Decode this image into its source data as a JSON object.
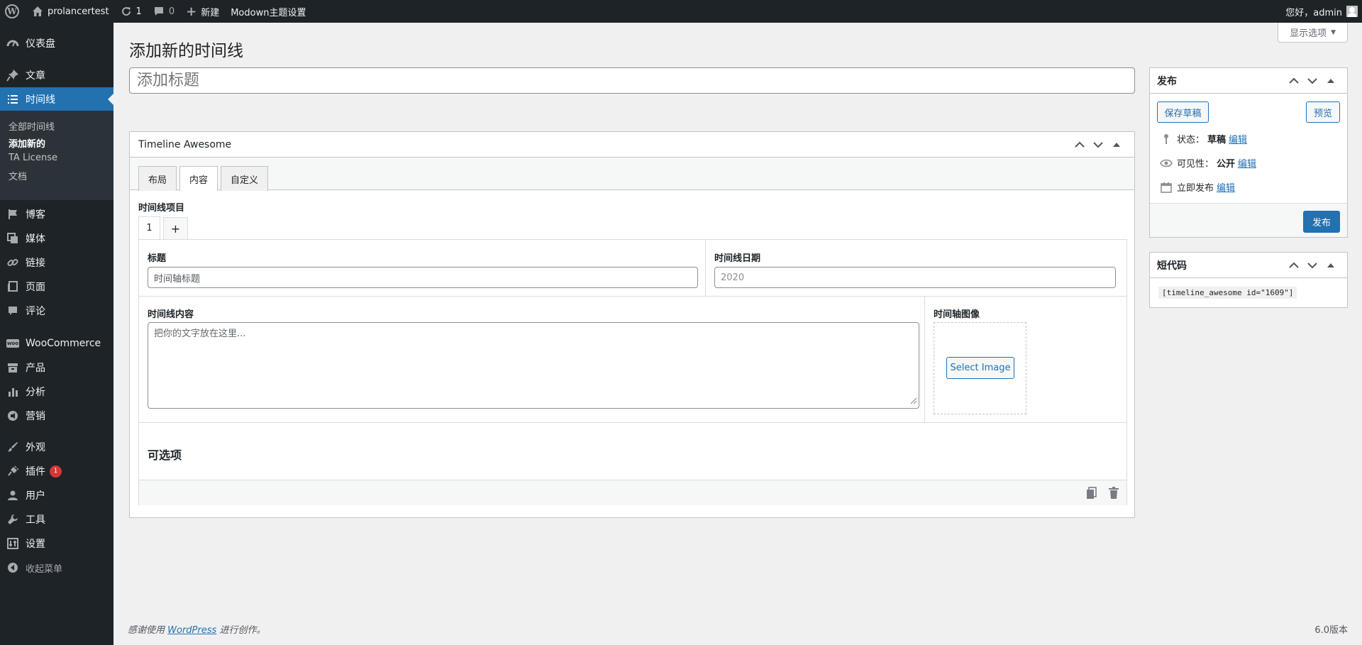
{
  "adminbar": {
    "site_name": "prolancertest",
    "updates_count": "1",
    "comments_count": "0",
    "new_label": "新建",
    "theme_settings": "Modown主题设置",
    "greeting": "您好，admin"
  },
  "sidebar": {
    "items": [
      {
        "label": "仪表盘",
        "icon": "dashboard-icon"
      },
      {
        "label": "文章",
        "icon": "pin-icon"
      },
      {
        "label": "时间线",
        "icon": "list-icon"
      },
      {
        "label": "博客",
        "icon": "flag-icon"
      },
      {
        "label": "媒体",
        "icon": "media-icon"
      },
      {
        "label": "链接",
        "icon": "link-icon"
      },
      {
        "label": "页面",
        "icon": "page-icon"
      },
      {
        "label": "评论",
        "icon": "comment-icon"
      },
      {
        "label": "WooCommerce",
        "icon": "woo-icon"
      },
      {
        "label": "产品",
        "icon": "archive-icon"
      },
      {
        "label": "分析",
        "icon": "chart-icon"
      },
      {
        "label": "营销",
        "icon": "megaphone-icon"
      },
      {
        "label": "外观",
        "icon": "brush-icon"
      },
      {
        "label": "插件",
        "icon": "plugin-icon"
      },
      {
        "label": "用户",
        "icon": "user-icon"
      },
      {
        "label": "工具",
        "icon": "wrench-icon"
      },
      {
        "label": "设置",
        "icon": "settings-icon"
      }
    ],
    "plugins_badge": "1",
    "submenu": [
      "全部时间线",
      "添加新的",
      "TA License",
      "文档"
    ],
    "collapse_label": "收起菜单"
  },
  "screen_options": "显示选项",
  "page_title": "添加新的时间线",
  "title_placeholder": "添加标题",
  "timeline_box": {
    "title": "Timeline Awesome",
    "tabs": [
      "布局",
      "内容",
      "自定义"
    ],
    "items_label": "时间线项目",
    "item_tabs": [
      "1",
      "+"
    ],
    "title_label": "标题",
    "title_value": "时间轴标题",
    "date_label": "时间线日期",
    "date_placeholder": "2020",
    "content_label": "时间线内容",
    "content_placeholder": "把你的文字放在这里...",
    "image_label": "时间轴图像",
    "select_image": "Select Image",
    "optional_label": "可选项"
  },
  "publish_box": {
    "title": "发布",
    "save_draft": "保存草稿",
    "preview": "预览",
    "status_label": "状态：",
    "status_value": "草稿",
    "visibility_label": "可见性：",
    "visibility_value": "公开",
    "publish_time": "立即发布",
    "edit_link": "编辑",
    "publish_button": "发布"
  },
  "shortcode_box": {
    "title": "短代码",
    "code": "[timeline_awesome id=\"1609\"]"
  },
  "footer": {
    "thanks_prefix": "感谢使用",
    "wordpress_link": "WordPress",
    "thanks_suffix": "进行创作。",
    "version": "6.0版本"
  },
  "colors": {
    "accent": "#2271b1",
    "sidebar_bg": "#1d2327",
    "submenu_bg": "#2c3338",
    "badge": "#d63638",
    "page_bg": "#f0f0f1"
  }
}
